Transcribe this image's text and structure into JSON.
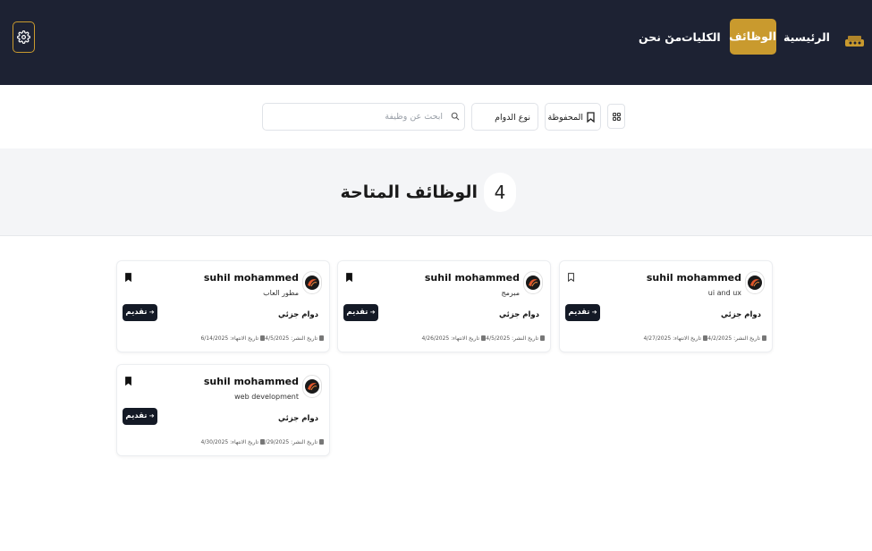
{
  "nav": {
    "home": "الرئيسية",
    "jobs": "الوظائف",
    "colleges": "الكليات",
    "about": "من نحن",
    "colleges_chevron": "⌄"
  },
  "toolbar": {
    "search_placeholder": "ابحث عن وظيفة",
    "job_type_filter": "نوع الدوام",
    "saved": "المحفوظة"
  },
  "hero": {
    "count": "4",
    "title": "الوظائف المتاحة"
  },
  "jobs": [
    {
      "poster": "suhil mohammed",
      "title": "ui and ux",
      "type": "دوام جزئي",
      "apply": "تقديم",
      "published": "تاريخ النشر: 4/2/2025",
      "end": "تاريخ الانتهاء: 4/27/2025",
      "saved": false
    },
    {
      "poster": "suhil mohammed",
      "title": "مبرمج",
      "type": "دوام جزئي",
      "apply": "تقديم",
      "published": "تاريخ النشر: 4/5/2025",
      "end": "تاريخ الانتهاء: 4/26/2025",
      "saved": true
    },
    {
      "poster": "suhil mohammed",
      "title": "مطور العاب",
      "type": "دوام جزئي",
      "apply": "تقديم",
      "published": "تاريخ النشر: 4/5/2025",
      "end": "تاريخ الانتهاء: 6/14/2025",
      "saved": true
    },
    {
      "poster": "suhil mohammed",
      "title": "web development",
      "type": "دوام جزئي",
      "apply": "تقديم",
      "published": "تاريخ النشر: 1/29/2025",
      "end": "تاريخ الانتهاء: 4/30/2025",
      "saved": true
    }
  ],
  "colors": {
    "nav_bg": "#1d2233",
    "accent": "#c99a2e",
    "apply_bg": "#141a26",
    "hero_bg": "#f4f5f7"
  },
  "icons": {
    "settings": "gear-icon",
    "search": "search-icon",
    "saved": "bookmark-icon",
    "grid": "grid-icon",
    "calendar": "calendar-icon",
    "arrow": "arrow-left-icon"
  }
}
